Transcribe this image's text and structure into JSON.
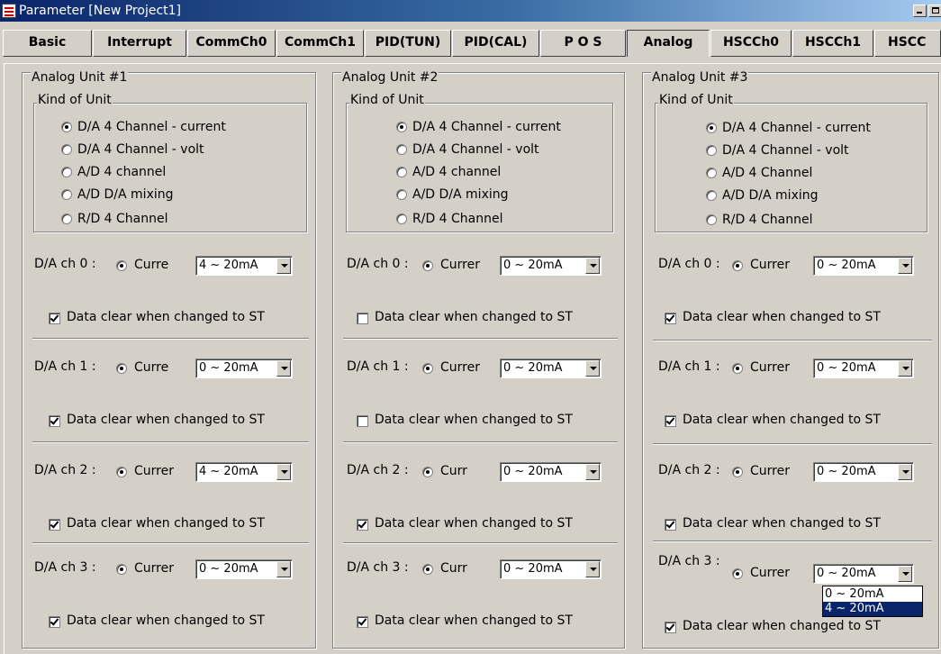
{
  "window": {
    "title": "Parameter [New Project1]"
  },
  "tabs": [
    {
      "label": "Basic"
    },
    {
      "label": "Interrupt"
    },
    {
      "label": "CommCh0"
    },
    {
      "label": "CommCh1"
    },
    {
      "label": "PID(TUN)"
    },
    {
      "label": "PID(CAL)"
    },
    {
      "label": "P O S"
    },
    {
      "label": "Analog",
      "active": true
    },
    {
      "label": "HSCCh0"
    },
    {
      "label": "HSCCh1"
    },
    {
      "label": "HSCC"
    }
  ],
  "units": [
    {
      "title": "Analog Unit #1",
      "kind_title": "Kind of Unit",
      "kinds": [
        "D/A 4 Channel - current",
        "D/A 4 Channel - volt",
        "A/D 4 channel",
        "A/D D/A mixing",
        "R/D 4 Channel"
      ],
      "selected_kind": 0,
      "channels": [
        {
          "label": "D/A ch 0 :",
          "current_label": "Curre",
          "range": "4 ~ 20mA",
          "clear_label": "Data clear when changed to ST",
          "clear_checked": true
        },
        {
          "label": "D/A ch 1 :",
          "current_label": "Curre",
          "range": "0 ~ 20mA",
          "clear_label": "Data clear when changed to ST",
          "clear_checked": true
        },
        {
          "label": "D/A ch 2 :",
          "current_label": "Currer",
          "range": "4 ~ 20mA",
          "clear_label": "Data clear when changed to ST",
          "clear_checked": true
        },
        {
          "label": "D/A ch 3 :",
          "current_label": "Currer",
          "range": "0 ~ 20mA",
          "clear_label": "Data clear when changed to ST",
          "clear_checked": true
        }
      ]
    },
    {
      "title": "Analog Unit #2",
      "kind_title": "Kind of Unit",
      "kinds": [
        "D/A 4 Channel - current",
        "D/A 4 Channel - volt",
        "A/D 4 channel",
        "A/D D/A mixing",
        "R/D 4 Channel"
      ],
      "selected_kind": 0,
      "channels": [
        {
          "label": "D/A ch 0 :",
          "current_label": "Currer",
          "range": "0 ~ 20mA",
          "clear_label": "Data clear when changed to ST",
          "clear_checked": false
        },
        {
          "label": "D/A ch 1 :",
          "current_label": "Currer",
          "range": "0 ~ 20mA",
          "clear_label": "Data clear when changed to ST",
          "clear_checked": false
        },
        {
          "label": "D/A ch 2 :",
          "current_label": "Curr",
          "range": "0 ~ 20mA",
          "clear_label": "Data clear when changed to ST",
          "clear_checked": true
        },
        {
          "label": "D/A ch 3 :",
          "current_label": "Curr",
          "range": "0 ~ 20mA",
          "clear_label": "Data clear when changed to ST",
          "clear_checked": true
        }
      ]
    },
    {
      "title": "Analog Unit #3",
      "kind_title": "Kind of Unit",
      "kinds": [
        "D/A 4 Channel - current",
        "D/A 4 Channel - volt",
        "A/D 4 Channel",
        "A/D D/A mixing",
        "R/D 4 Channel"
      ],
      "selected_kind": 0,
      "channels": [
        {
          "label": "D/A ch 0 :",
          "current_label": "Currer",
          "range": "0 ~ 20mA",
          "clear_label": "Data clear when changed to ST",
          "clear_checked": true
        },
        {
          "label": "D/A ch 1 :",
          "current_label": "Currer",
          "range": "0 ~ 20mA",
          "clear_label": "Data clear when changed to ST",
          "clear_checked": true
        },
        {
          "label": "D/A ch 2 :",
          "current_label": "Currer",
          "range": "0 ~ 20mA",
          "clear_label": "Data clear when changed to ST",
          "clear_checked": true
        },
        {
          "label": "D/A ch 3 :",
          "current_label": "Currer",
          "range": "0 ~ 20mA",
          "clear_label": "Data clear when changed to ST",
          "clear_checked": true
        }
      ]
    }
  ],
  "dropdown": {
    "options": [
      "0 ~ 20mA",
      "4 ~ 20mA"
    ],
    "highlighted": 1
  }
}
